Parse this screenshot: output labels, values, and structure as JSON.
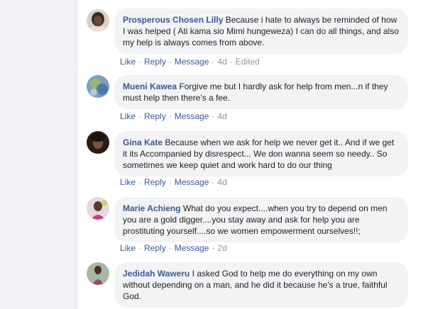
{
  "comments": [
    {
      "author": "Prosperous Chosen Lilly",
      "text": "Because i hate to always be reminded of how I was helped ( Ati kama sio Mimi hungeweza) I can do all things, and also my help is always comes from above.",
      "like": "Like",
      "reply": "Reply",
      "message": "Message",
      "time": "4d",
      "edited": "Edited",
      "avatar_color": "#5a4a45"
    },
    {
      "author": "Mueni Kawea",
      "text": "Forgive me but I hardly ask for help from men...n if they must help then there's a fee.",
      "like": "Like",
      "reply": "Reply",
      "message": "Message",
      "time": "4d",
      "avatar_color": "#6f8fb3"
    },
    {
      "author": "Gina Kate",
      "text": "Because when we ask for help we never get it.. And if we get it its Accompanied by disrespect... We don wanna seem so needy.. So sometimes we keep quiet and work hard to do our thing",
      "like": "Like",
      "reply": "Reply",
      "message": "Message",
      "time": "4d",
      "avatar_color": "#4b3428"
    },
    {
      "author": "Marie Achieng",
      "text": "What do you expect....when you try to depend on men you are a gold digger....you stay away and ask for help you are prostituting yourself....so we women empowerment ourselves!!;",
      "like": "Like",
      "reply": "Reply",
      "message": "Message",
      "time": "2d",
      "avatar_color": "#c45c8a"
    },
    {
      "author": "Jedidah Waweru",
      "text": "I asked God to help me do everything on my own without depending on a man, and he did it because he's a true, faithful God.",
      "avatar_color": "#8a6a8a"
    }
  ],
  "colors": {
    "link": "#385898",
    "bubble": "#f2f3f5",
    "text": "#1c1e21",
    "meta": "#90949c",
    "gutter": "#f0f2f5"
  }
}
